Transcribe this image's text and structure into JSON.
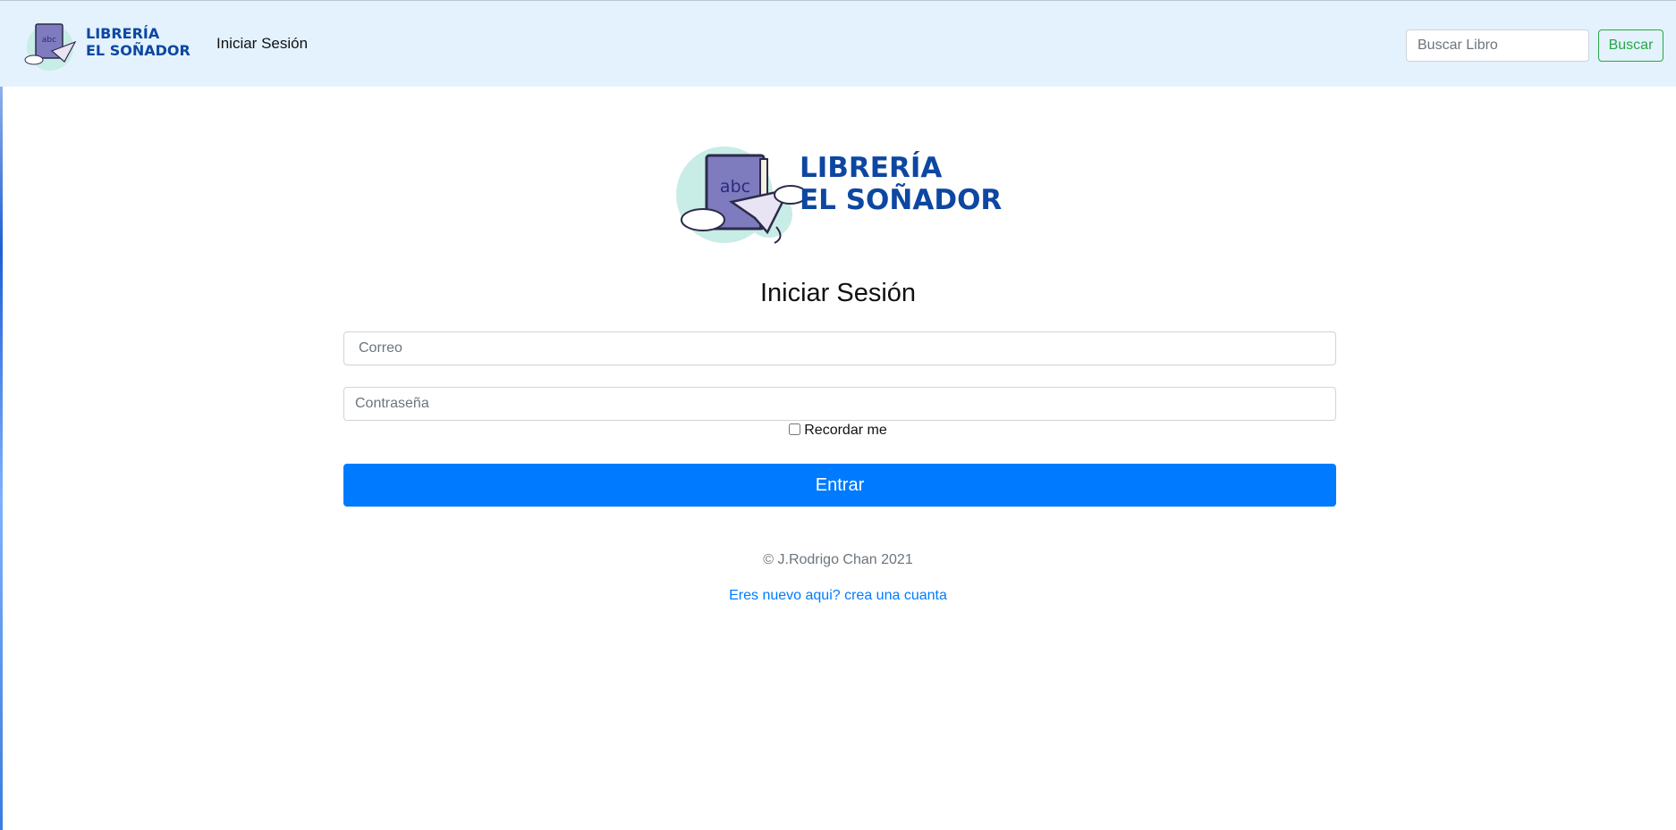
{
  "navbar": {
    "logo": {
      "line1": "LIBRERÍA",
      "line2": "EL SOÑADOR",
      "book_label": "abc"
    },
    "login_link": "Iniciar Sesión",
    "search_placeholder": "Buscar Libro",
    "search_button": "Buscar"
  },
  "main": {
    "logo": {
      "line1": "LIBRERÍA",
      "line2": "EL SOÑADOR",
      "book_label": "abc"
    },
    "title": "Iniciar Sesión",
    "email_placeholder": "Correo",
    "password_placeholder": "Contraseña",
    "remember_label": "Recordar me",
    "submit_label": "Entrar",
    "copyright": "© J.Rodrigo Chan 2021",
    "signup_link": "Eres nuevo aqui? crea una cuanta"
  },
  "colors": {
    "navbar_bg": "#e3f2fd",
    "primary": "#007bff",
    "success": "#28a745",
    "logo_blue": "#0d47a1"
  }
}
